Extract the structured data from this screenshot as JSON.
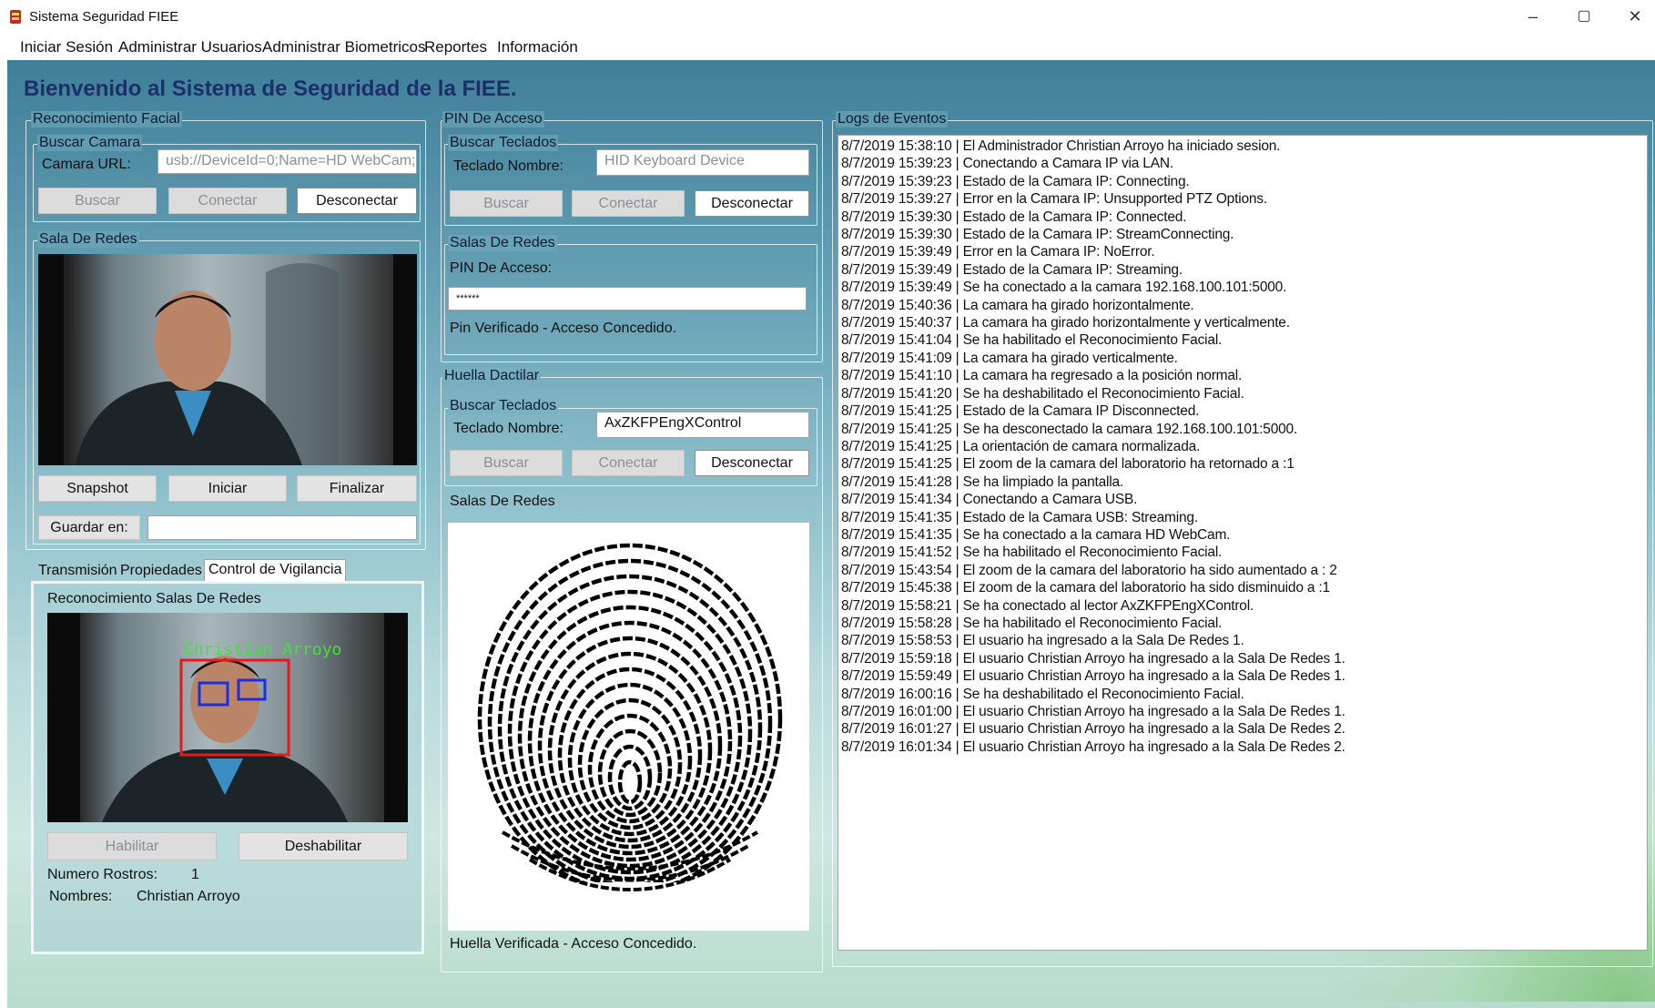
{
  "window": {
    "title": "Sistema Seguridad FIEE",
    "controls": {
      "minimize": "–",
      "maximize": "▢",
      "close": "✕"
    }
  },
  "menu": [
    "Iniciar Sesión",
    "Administrar Usuarios",
    "Administrar Biometricos",
    "Reportes",
    "Información"
  ],
  "welcome": "Bienvenido al Sistema de Seguridad de la FIEE.",
  "facial": {
    "legend": "Reconocimiento Facial",
    "buscar_camara": {
      "legend": "Buscar Camara",
      "url_label": "Camara URL:",
      "url_value": "usb://DeviceId=0;Name=HD WebCam;",
      "buttons": {
        "buscar": "Buscar",
        "conectar": "Conectar",
        "desconectar": "Desconectar"
      }
    },
    "sala": {
      "legend": "Sala De Redes",
      "buttons": {
        "snapshot": "Snapshot",
        "iniciar": "Iniciar",
        "finalizar": "Finalizar"
      },
      "guardar_label": "Guardar en:",
      "guardar_value": ""
    }
  },
  "tabs": {
    "transmision": "Transmisión",
    "propiedades": "Propiedades",
    "control": "Control de Vigilancia"
  },
  "vigilancia": {
    "legend": "Reconocimiento Salas De Redes",
    "overlay_name": "Christian Arroyo",
    "buttons": {
      "habilitar": "Habilitar",
      "deshabilitar": "Deshabilitar"
    },
    "numero_label": "Numero Rostros:",
    "numero_value": "1",
    "nombres_label": "Nombres:",
    "nombres_value": "Christian Arroyo"
  },
  "pin": {
    "legend": "PIN De Acceso",
    "buscar": {
      "legend": "Buscar Teclados",
      "nombre_label": "Teclado Nombre:",
      "nombre_value": "HID Keyboard Device",
      "buttons": {
        "buscar": "Buscar",
        "conectar": "Conectar",
        "desconectar": "Desconectar"
      }
    },
    "salas": {
      "legend": "Salas De Redes",
      "pin_label": "PIN De Acceso:",
      "pin_value": "******",
      "status": "Pin Verificado - Acceso Concedido."
    }
  },
  "huella": {
    "legend": "Huella Dactilar",
    "buscar": {
      "legend": "Buscar Teclados",
      "nombre_label": "Teclado Nombre:",
      "nombre_value": "AxZKFPEngXControl",
      "buttons": {
        "buscar": "Buscar",
        "conectar": "Conectar",
        "desconectar": "Desconectar"
      }
    },
    "salas_label": "Salas De Redes",
    "status": "Huella Verificada - Acceso Concedido."
  },
  "logs": {
    "legend": "Logs de Eventos",
    "lines": [
      "8/7/2019 15:38:10 | El Administrador Christian Arroyo ha iniciado sesion.",
      "8/7/2019 15:39:23 | Conectando a Camara IP via LAN.",
      "8/7/2019 15:39:23 | Estado de la Camara IP: Connecting.",
      "8/7/2019 15:39:27 | Error en la Camara IP: Unsupported PTZ Options.",
      "8/7/2019 15:39:30 | Estado de la Camara IP: Connected.",
      "8/7/2019 15:39:30 | Estado de la Camara IP: StreamConnecting.",
      "8/7/2019 15:39:49 | Error en la Camara IP: NoError.",
      "8/7/2019 15:39:49 | Estado de la Camara IP: Streaming.",
      "8/7/2019 15:39:49 | Se ha conectado a la camara 192.168.100.101:5000.",
      "8/7/2019 15:40:36 | La camara ha girado horizontalmente.",
      "8/7/2019 15:40:37 | La camara ha girado horizontalmente y verticalmente.",
      "8/7/2019 15:41:04 | Se ha habilitado el Reconocimiento Facial.",
      "8/7/2019 15:41:09 | La camara ha girado verticalmente.",
      "8/7/2019 15:41:10 | La camara ha regresado a la posición normal.",
      "8/7/2019 15:41:20 | Se ha deshabilitado el Reconocimiento Facial.",
      "8/7/2019 15:41:25 | Estado de la Camara IP Disconnected.",
      "8/7/2019 15:41:25 | Se ha desconectado la camara 192.168.100.101:5000.",
      "8/7/2019 15:41:25 | La orientación de camara normalizada.",
      "8/7/2019 15:41:25 | El zoom de la camara del laboratorio ha retornado a :1",
      "8/7/2019 15:41:28 | Se ha limpiado la pantalla.",
      "8/7/2019 15:41:34 | Conectando a Camara USB.",
      "8/7/2019 15:41:35 | Estado de la Camara USB: Streaming.",
      "8/7/2019 15:41:35 | Se ha conectado a la camara HD WebCam.",
      "8/7/2019 15:41:52 | Se ha habilitado el Reconocimiento Facial.",
      "8/7/2019 15:43:54 | El zoom de la camara del laboratorio ha sido aumentado a : 2",
      "8/7/2019 15:45:38 | El zoom de la camara del laboratorio ha sido disminuido a :1",
      "8/7/2019 15:58:21 | Se ha conectado al lector AxZKFPEngXControl.",
      "8/7/2019 15:58:28 | Se ha habilitado el Reconocimiento Facial.",
      "8/7/2019 15:58:53 | El usuario   ha ingresado a la Sala De Redes 1.",
      "8/7/2019 15:59:18 | El usuario Christian Arroyo  ha ingresado a la Sala De Redes 1.",
      "8/7/2019 15:59:49 | El usuario Christian Arroyo  ha ingresado a la Sala De Redes 1.",
      "8/7/2019 16:00:16 | Se ha deshabilitado el Reconocimiento Facial.",
      "8/7/2019 16:01:00 | El usuario Christian Arroyo ha ingresado a la Sala De Redes 1.",
      "8/7/2019 16:01:27 | El usuario Christian Arroyo ha ingresado a la Sala De Redes 2.",
      "8/7/2019 16:01:34 | El usuario Christian Arroyo ha ingresado a la Sala De Redes 2."
    ]
  }
}
